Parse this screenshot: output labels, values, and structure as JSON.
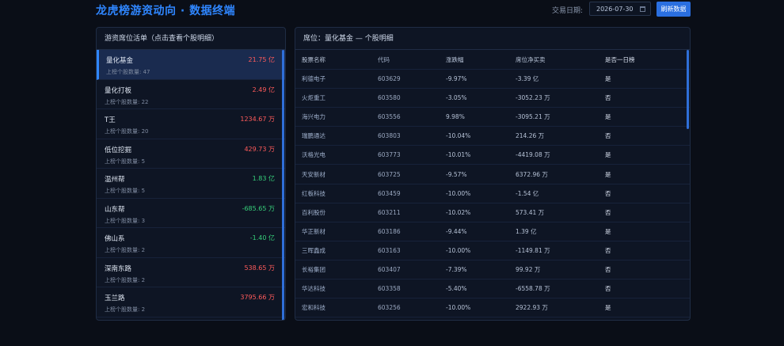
{
  "header": {
    "title": "龙虎榜游资动向 · 数据终端",
    "date_label": "交易日期:",
    "date_value": "2026-07-30",
    "refresh_label": "刷新数据"
  },
  "left": {
    "title": "游资席位活单（点击查看个股明细）",
    "items": [
      {
        "name": "量化基金",
        "sub": "上榜个股数量: 47",
        "amount": "21.75 亿",
        "sign": "pos"
      },
      {
        "name": "量化打板",
        "sub": "上榜个股数量: 22",
        "amount": "2.49 亿",
        "sign": "pos"
      },
      {
        "name": "T王",
        "sub": "上榜个股数量: 20",
        "amount": "1234.67 万",
        "sign": "pos"
      },
      {
        "name": "低位挖掘",
        "sub": "上榜个股数量: 5",
        "amount": "429.73 万",
        "sign": "pos"
      },
      {
        "name": "温州帮",
        "sub": "上榜个股数量: 5",
        "amount": "1.83 亿",
        "sign": "neg"
      },
      {
        "name": "山东帮",
        "sub": "上榜个股数量: 3",
        "amount": "-685.65 万",
        "sign": "neg"
      },
      {
        "name": "佛山系",
        "sub": "上榜个股数量: 2",
        "amount": "-1.40 亿",
        "sign": "neg"
      },
      {
        "name": "深南东路",
        "sub": "上榜个股数量: 2",
        "amount": "538.65 万",
        "sign": "pos"
      },
      {
        "name": "玉兰路",
        "sub": "上榜个股数量: 2",
        "amount": "3795.66 万",
        "sign": "pos"
      }
    ]
  },
  "right": {
    "title": "席位：量化基金 — 个股明细",
    "columns": [
      "股票名称",
      "代码",
      "涨跌幅",
      "席位净买卖",
      "是否一日榜"
    ],
    "rows": [
      {
        "name": "利德电子",
        "code": "603629",
        "chg": "-9.97%",
        "chg_sign": "neg",
        "net": "-3.39 亿",
        "net_sign": "neg",
        "flag": "是"
      },
      {
        "name": "火炬重工",
        "code": "603580",
        "chg": "-3.05%",
        "chg_sign": "neg",
        "net": "-3052.23 万",
        "net_sign": "neg",
        "flag": "否"
      },
      {
        "name": "海兴电力",
        "code": "603556",
        "chg": "9.98%",
        "chg_sign": "pos",
        "net": "-3095.21 万",
        "net_sign": "neg",
        "flag": "是"
      },
      {
        "name": "瑞鹏通达",
        "code": "603803",
        "chg": "-10.04%",
        "chg_sign": "neg",
        "net": "214.26 万",
        "net_sign": "pos",
        "flag": "否"
      },
      {
        "name": "沃格光电",
        "code": "603773",
        "chg": "-10.01%",
        "chg_sign": "neg",
        "net": "-4419.08 万",
        "net_sign": "neg",
        "flag": "是"
      },
      {
        "name": "天安新材",
        "code": "603725",
        "chg": "-9.57%",
        "chg_sign": "neg",
        "net": "6372.96 万",
        "net_sign": "pos",
        "flag": "是"
      },
      {
        "name": "红板科技",
        "code": "603459",
        "chg": "-10.00%",
        "chg_sign": "neg",
        "net": "-1.54 亿",
        "net_sign": "neg",
        "flag": "否"
      },
      {
        "name": "百利股份",
        "code": "603211",
        "chg": "-10.02%",
        "chg_sign": "neg",
        "net": "573.41 万",
        "net_sign": "pos",
        "flag": "否"
      },
      {
        "name": "华正新材",
        "code": "603186",
        "chg": "-9.44%",
        "chg_sign": "neg",
        "net": "1.39 亿",
        "net_sign": "pos",
        "flag": "是"
      },
      {
        "name": "三晖鑫成",
        "code": "603163",
        "chg": "-10.00%",
        "chg_sign": "neg",
        "net": "-1149.81 万",
        "net_sign": "neg",
        "flag": "否"
      },
      {
        "name": "长裕集团",
        "code": "603407",
        "chg": "-7.39%",
        "chg_sign": "neg",
        "net": "99.92 万",
        "net_sign": "pos",
        "flag": "否"
      },
      {
        "name": "华达科技",
        "code": "603358",
        "chg": "-5.40%",
        "chg_sign": "neg",
        "net": "-6558.78 万",
        "net_sign": "neg",
        "flag": "否"
      },
      {
        "name": "宏和科技",
        "code": "603256",
        "chg": "-10.00%",
        "chg_sign": "neg",
        "net": "2922.93 万",
        "net_sign": "pos",
        "flag": "是"
      }
    ]
  },
  "colors": {
    "accent": "#2f86ff",
    "up": "#ff5b5b",
    "down": "#36d07a"
  }
}
